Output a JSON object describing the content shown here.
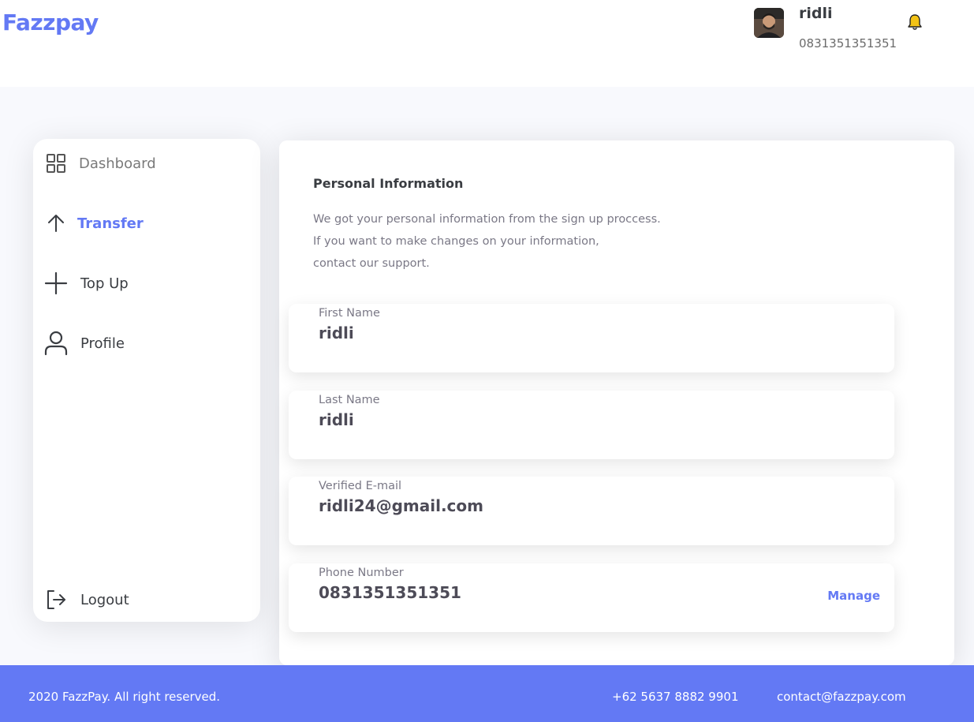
{
  "header": {
    "brand": "Fazzpay",
    "user_name": "ridli",
    "user_phone": "0831351351351",
    "avatar_icon": "user-photo",
    "bell_icon": "bell-icon",
    "bell_color": "#f3c316"
  },
  "sidebar": {
    "items": [
      {
        "label": "Dashboard",
        "icon": "grid-icon"
      },
      {
        "label": "Transfer",
        "icon": "arrow-up-icon",
        "active": true
      },
      {
        "label": "Top Up",
        "icon": "plus-icon"
      },
      {
        "label": "Profile",
        "icon": "user-icon"
      }
    ],
    "logout": {
      "label": "Logout",
      "icon": "logout-icon"
    }
  },
  "content": {
    "title": "Personal Information",
    "description": [
      "We got your personal information from the sign up proccess.",
      "If you want to make changes on your information,",
      "contact our support."
    ],
    "fields": [
      {
        "label": "First Name",
        "value": "ridli"
      },
      {
        "label": "Last Name",
        "value": "ridli"
      },
      {
        "label": "Verified E-mail",
        "value": "ridli24@gmail.com"
      },
      {
        "label": "Phone Number",
        "value": "0831351351351",
        "action": "Manage"
      }
    ]
  },
  "footer": {
    "copyright": "2020 FazzPay. All right reserved.",
    "phone": "+62 5637 8882 9901",
    "email": "contact@fazzpay.com"
  },
  "colors": {
    "accent": "#6379f4",
    "background": "#f8f9fd"
  }
}
